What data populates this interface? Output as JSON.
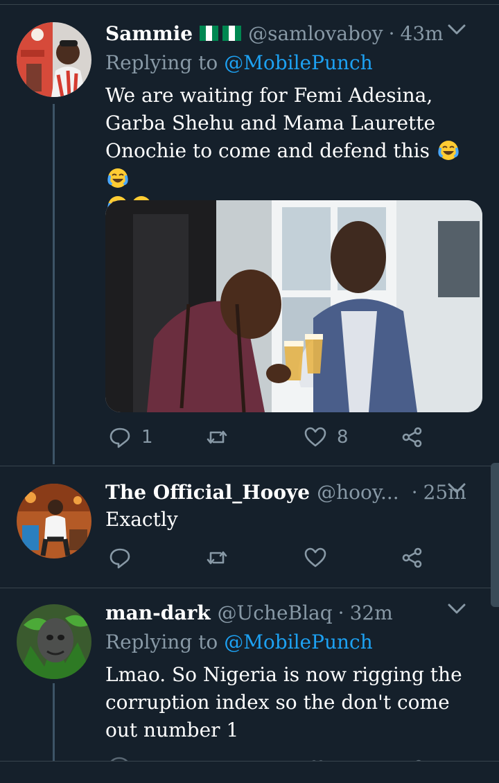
{
  "tweets": [
    {
      "name": "Sammie",
      "flag": "🇳🇬🇳🇬",
      "handle": "@samlovaboy",
      "separator": "·",
      "time": "43m",
      "replying_prefix": "Replying to",
      "replying_to": "@MobilePunch",
      "text": "We are waiting for Femi Adesina, Garba Shehu and Mama Laurette Onochie to come and defend this",
      "emojis": [
        "face-with-tears-of-joy",
        "face-with-tears-of-joy",
        "face-with-tears-of-joy",
        "face-with-tears-of-joy"
      ],
      "has_photo": true,
      "reply_count": "1",
      "retweet_count": "",
      "like_count": "8"
    },
    {
      "name": "The Official_Hooye",
      "handle": "@hooy...",
      "separator": "·",
      "time": "25m",
      "text": "Exactly",
      "reply_count": "",
      "retweet_count": "",
      "like_count": ""
    },
    {
      "name": "man-dark",
      "handle": "@UcheBlaq",
      "separator": "·",
      "time": "32m",
      "replying_prefix": "Replying to",
      "replying_to": "@MobilePunch",
      "text": "Lmao. So Nigeria is now rigging the corruption index so the don't come out number 1"
    }
  ],
  "colors": {
    "background": "#15202b",
    "secondary_text": "#8899a6",
    "link": "#1da1f2",
    "divider": "#38444d",
    "thread_line": "#3d5466"
  },
  "icons": {
    "reply": "reply-icon",
    "retweet": "retweet-icon",
    "like": "heart-icon",
    "share": "share-icon",
    "caret": "chevron-down-icon"
  }
}
